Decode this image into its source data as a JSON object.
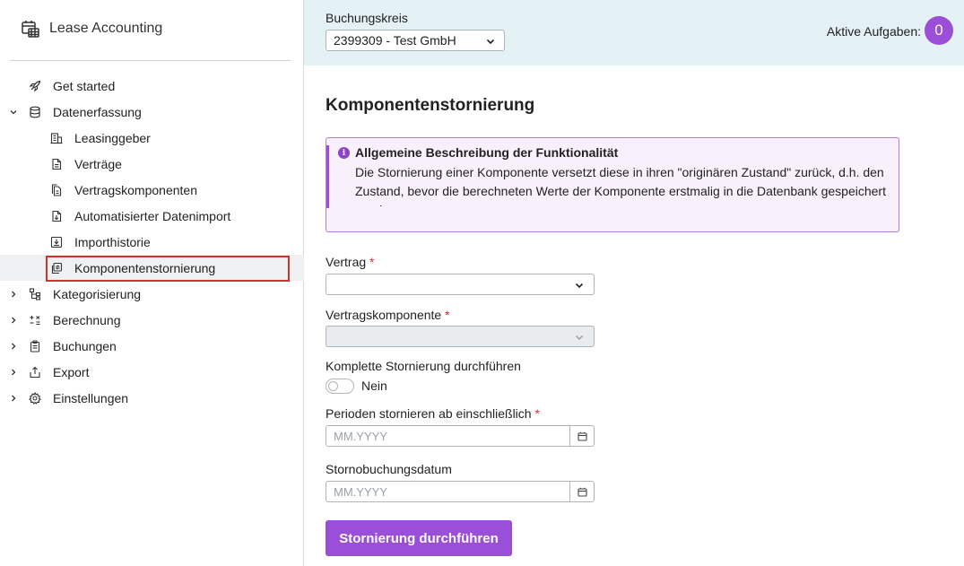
{
  "app": {
    "title": "Lease Accounting"
  },
  "sidebar": {
    "items": [
      {
        "label": "Get started"
      },
      {
        "label": "Datenerfassung"
      },
      {
        "label": "Leasinggeber"
      },
      {
        "label": "Verträge"
      },
      {
        "label": "Vertragskomponenten"
      },
      {
        "label": "Automatisierter Datenimport"
      },
      {
        "label": "Importhistorie"
      },
      {
        "label": "Komponentenstornierung"
      },
      {
        "label": "Kategorisierung"
      },
      {
        "label": "Berechnung"
      },
      {
        "label": "Buchungen"
      },
      {
        "label": "Export"
      },
      {
        "label": "Einstellungen"
      }
    ]
  },
  "topbar": {
    "buchungskreis_label": "Buchungskreis",
    "buchungskreis_value": "2399309 - Test GmbH",
    "tasks_label": "Aktive Aufgaben:",
    "tasks_count": "0"
  },
  "page": {
    "title": "Komponentenstornierung",
    "info_title": "Allgemeine Beschreibung der Funktionalität",
    "info_text": "Die Stornierung einer Komponente versetzt diese in ihren \"originären Zustand\" zurück, d.h. den Zustand, bevor die berechneten Werte der Komponente erstmalig in die Datenbank gespeichert werden."
  },
  "form": {
    "vertrag_label": "Vertrag",
    "vertragskomponente_label": "Vertragskomponente",
    "komplett_label": "Komplette Stornierung durchführen",
    "komplett_value": "Nein",
    "perioden_label": "Perioden stornieren ab einschließlich",
    "perioden_placeholder": "MM.YYYY",
    "storno_datum_label": "Stornobuchungsdatum",
    "storno_datum_placeholder": "MM.YYYY",
    "required_mark": "*",
    "submit_label": "Stornierung durchführen"
  },
  "colors": {
    "accent": "#9b4fd8",
    "topbar_bg": "#e4f1f5",
    "info_bg": "#f8f1fb",
    "required": "#d32f2f"
  }
}
